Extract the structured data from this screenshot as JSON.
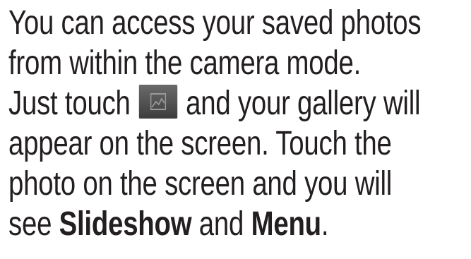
{
  "paragraph": {
    "line1": "You can access your saved photos",
    "line2": "from within the camera mode.",
    "line3_before": "Just touch",
    "line3_after": "and your gallery will",
    "line4": "appear on the screen. Touch the",
    "line5": "photo on the screen and you will",
    "line6_start": "see ",
    "line6_slideshow": "Slideshow",
    "line6_and": " and ",
    "line6_menu": "Menu",
    "line6_end": "."
  },
  "icons": {
    "gallery": "gallery-icon"
  }
}
